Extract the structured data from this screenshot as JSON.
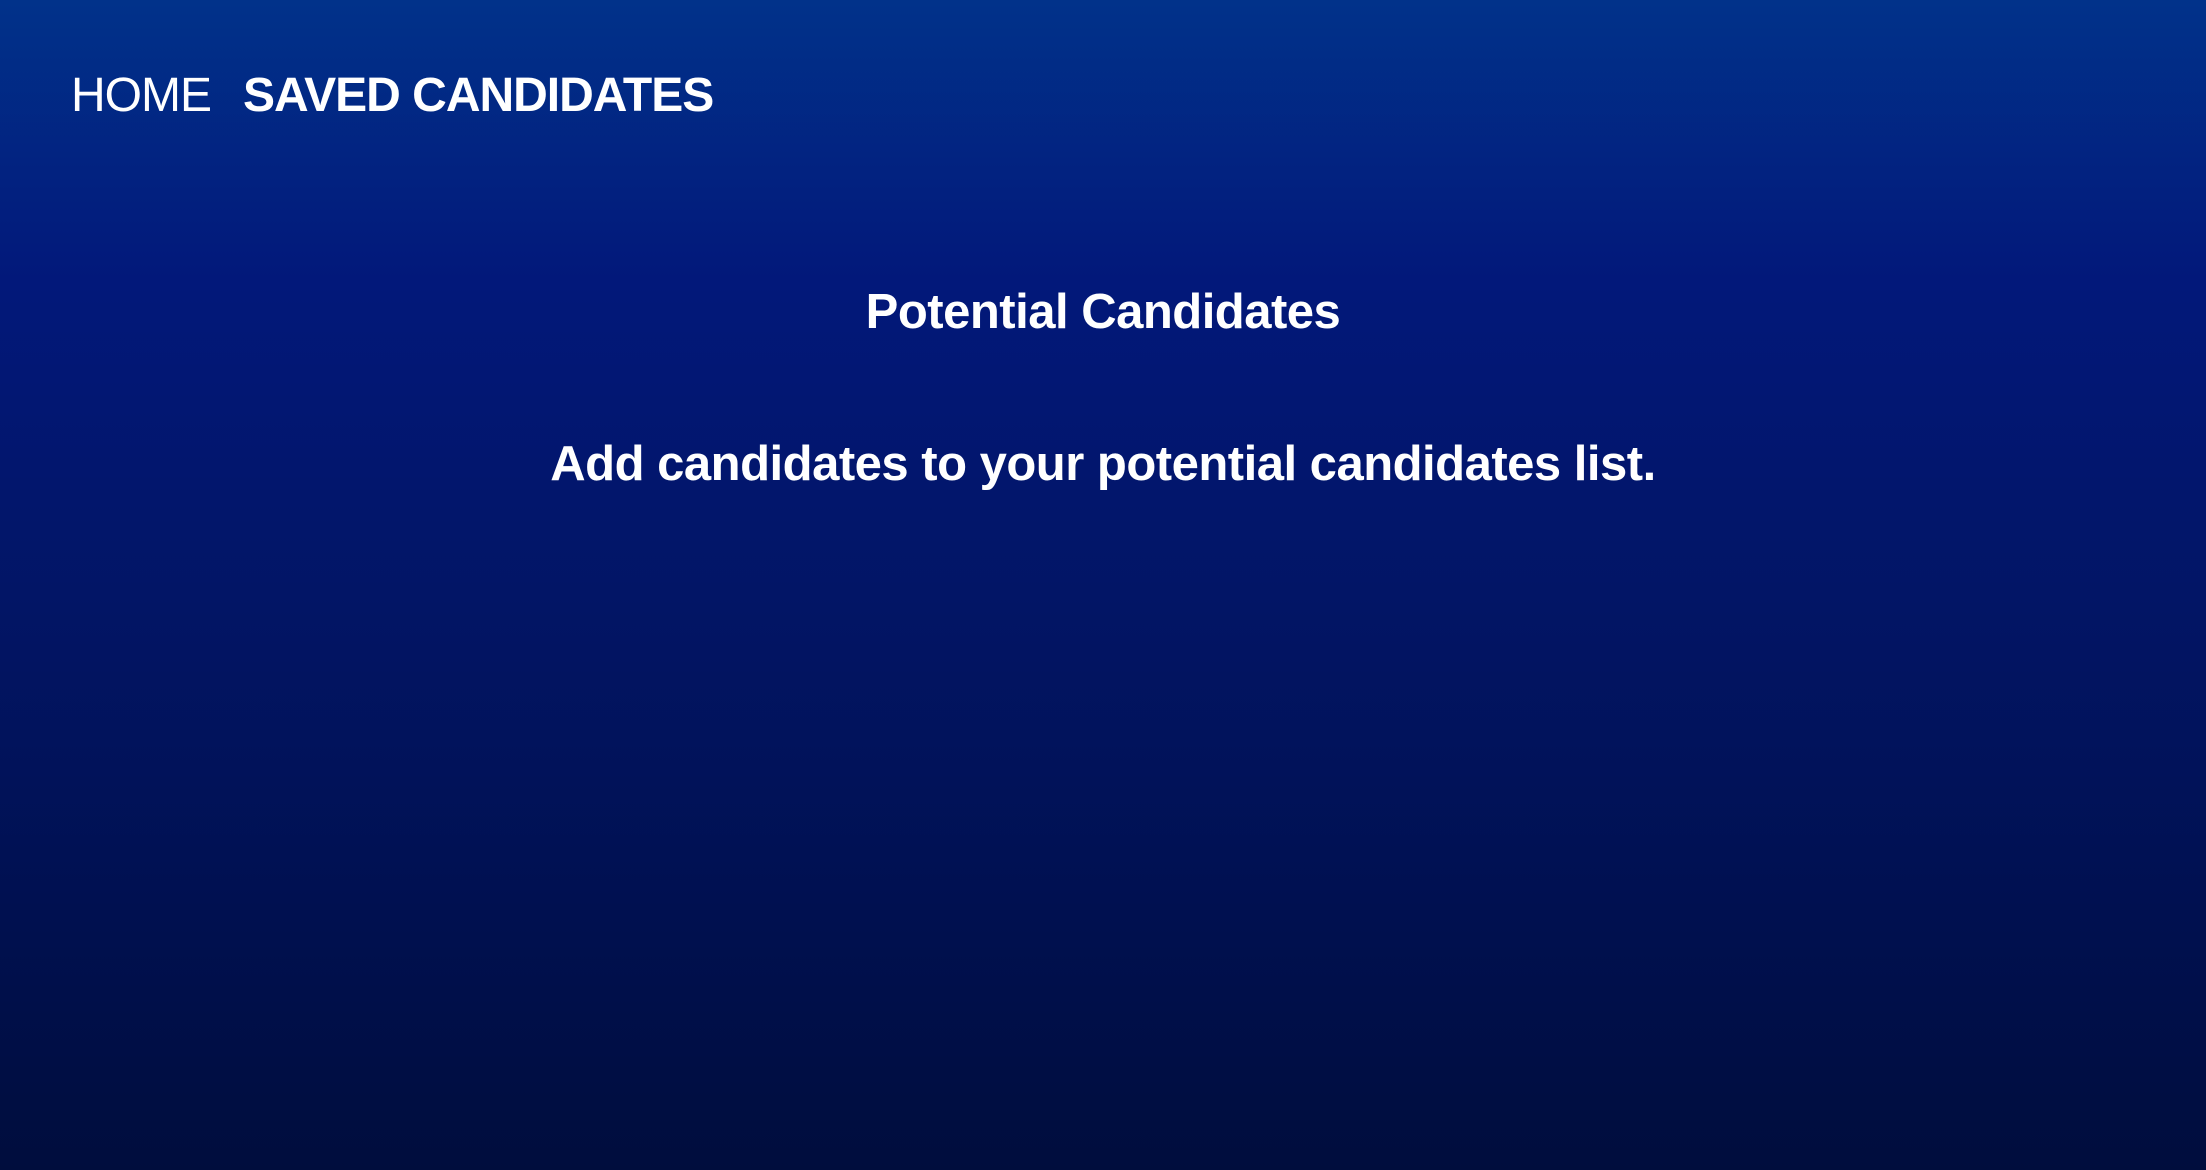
{
  "nav": {
    "home_label": "HOME",
    "saved_label": "SAVED CANDIDATES"
  },
  "main": {
    "title": "Potential Candidates",
    "empty_message": "Add candidates to your potential candidates list."
  },
  "colors": {
    "background_top": "#01328a",
    "background_bottom": "#000d3d",
    "text": "#ffffff"
  }
}
